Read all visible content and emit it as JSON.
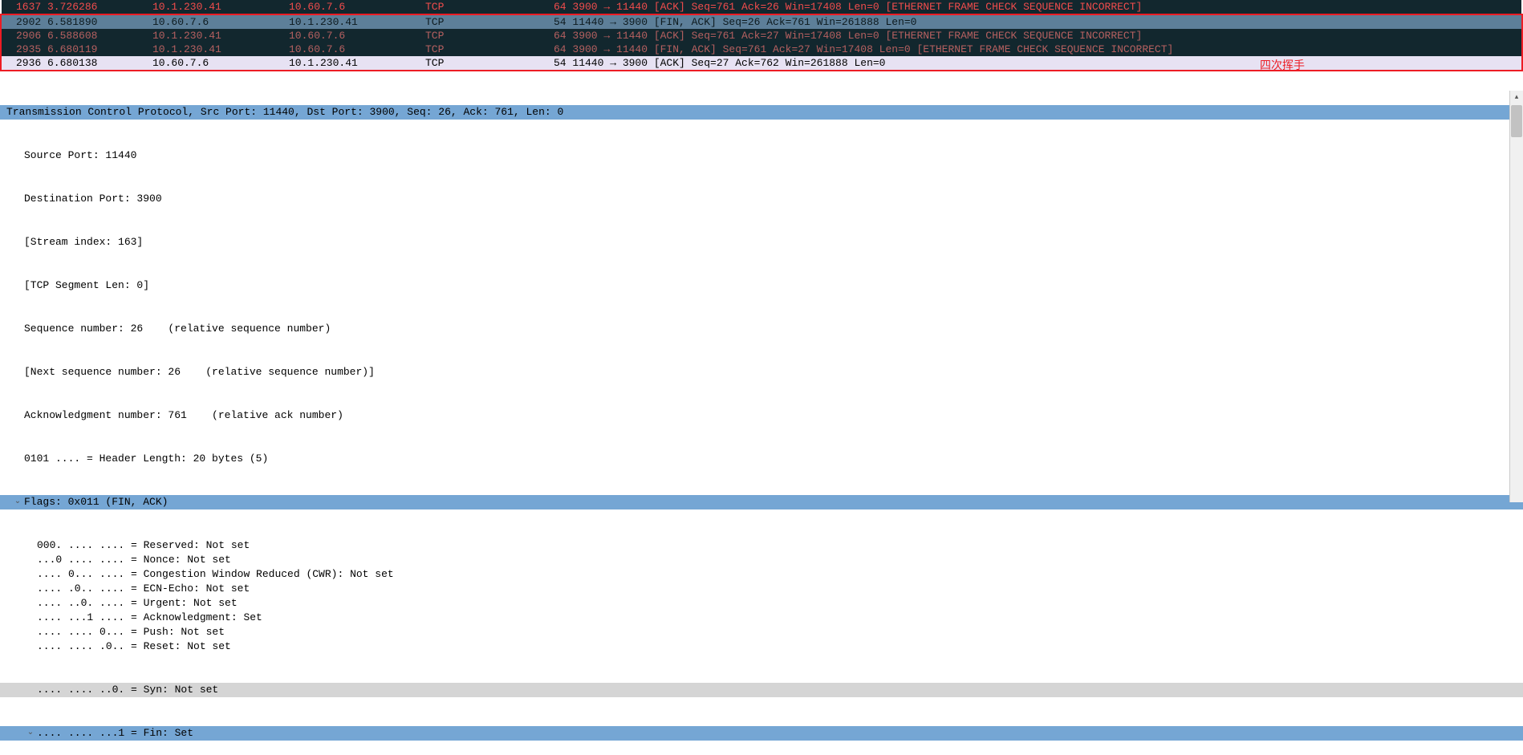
{
  "packets": [
    {
      "no": "1637",
      "time": "3.726286",
      "src": "10.1.230.41",
      "dst": "10.60.7.6",
      "proto": "TCP",
      "info": "64 3900 → 11440 [ACK] Seq=761 Ack=26 Win=17408 Len=0 [ETHERNET FRAME CHECK SEQUENCE INCORRECT]",
      "style": "row-red-dark"
    },
    {
      "no": "2902",
      "time": "6.581890",
      "src": "10.60.7.6",
      "dst": "10.1.230.41",
      "proto": "TCP",
      "info": "54 11440 → 3900 [FIN, ACK] Seq=26 Ack=761 Win=261888 Len=0",
      "style": "row-selected"
    },
    {
      "no": "2906",
      "time": "6.588608",
      "src": "10.1.230.41",
      "dst": "10.60.7.6",
      "proto": "TCP",
      "info": "64 3900 → 11440 [ACK] Seq=761 Ack=27 Win=17408 Len=0 [ETHERNET FRAME CHECK SEQUENCE INCORRECT]",
      "style": "row-teal-dark"
    },
    {
      "no": "2935",
      "time": "6.680119",
      "src": "10.1.230.41",
      "dst": "10.60.7.6",
      "proto": "TCP",
      "info": "64 3900 → 11440 [FIN, ACK] Seq=761 Ack=27 Win=17408 Len=0 [ETHERNET FRAME CHECK SEQUENCE INCORRECT]",
      "style": "row-teal-dark"
    },
    {
      "no": "2936",
      "time": "6.680138",
      "src": "10.60.7.6",
      "dst": "10.1.230.41",
      "proto": "TCP",
      "info": "54 11440 → 3900 [ACK] Seq=27 Ack=762 Win=261888 Len=0",
      "style": "row-light"
    }
  ],
  "annotation": "四次挥手",
  "detail": {
    "header": "Transmission Control Protocol, Src Port: 11440, Dst Port: 3900, Seq: 26, Ack: 761, Len: 0",
    "source_port": "Source Port: 11440",
    "dest_port": "Destination Port: 3900",
    "stream_index": "[Stream index: 163]",
    "tcp_seg_len": "[TCP Segment Len: 0]",
    "seq_num": "Sequence number: 26    (relative sequence number)",
    "next_seq": "[Next sequence number: 26    (relative sequence number)]",
    "ack_num": "Acknowledgment number: 761    (relative ack number)",
    "hdr_len": "0101 .... = Header Length: 20 bytes (5)",
    "flags_header": "Flags: 0x011 (FIN, ACK)",
    "flags": [
      "000. .... .... = Reserved: Not set",
      "...0 .... .... = Nonce: Not set",
      ".... 0... .... = Congestion Window Reduced (CWR): Not set",
      ".... .0.. .... = ECN-Echo: Not set",
      ".... ..0. .... = Urgent: Not set",
      ".... ...1 .... = Acknowledgment: Set",
      ".... .... 0... = Push: Not set",
      ".... .... .0.. = Reset: Not set"
    ],
    "syn_line": ".... .... ..0. = Syn: Not set",
    "fin_line": ".... .... ...1 = Fin: Set"
  }
}
